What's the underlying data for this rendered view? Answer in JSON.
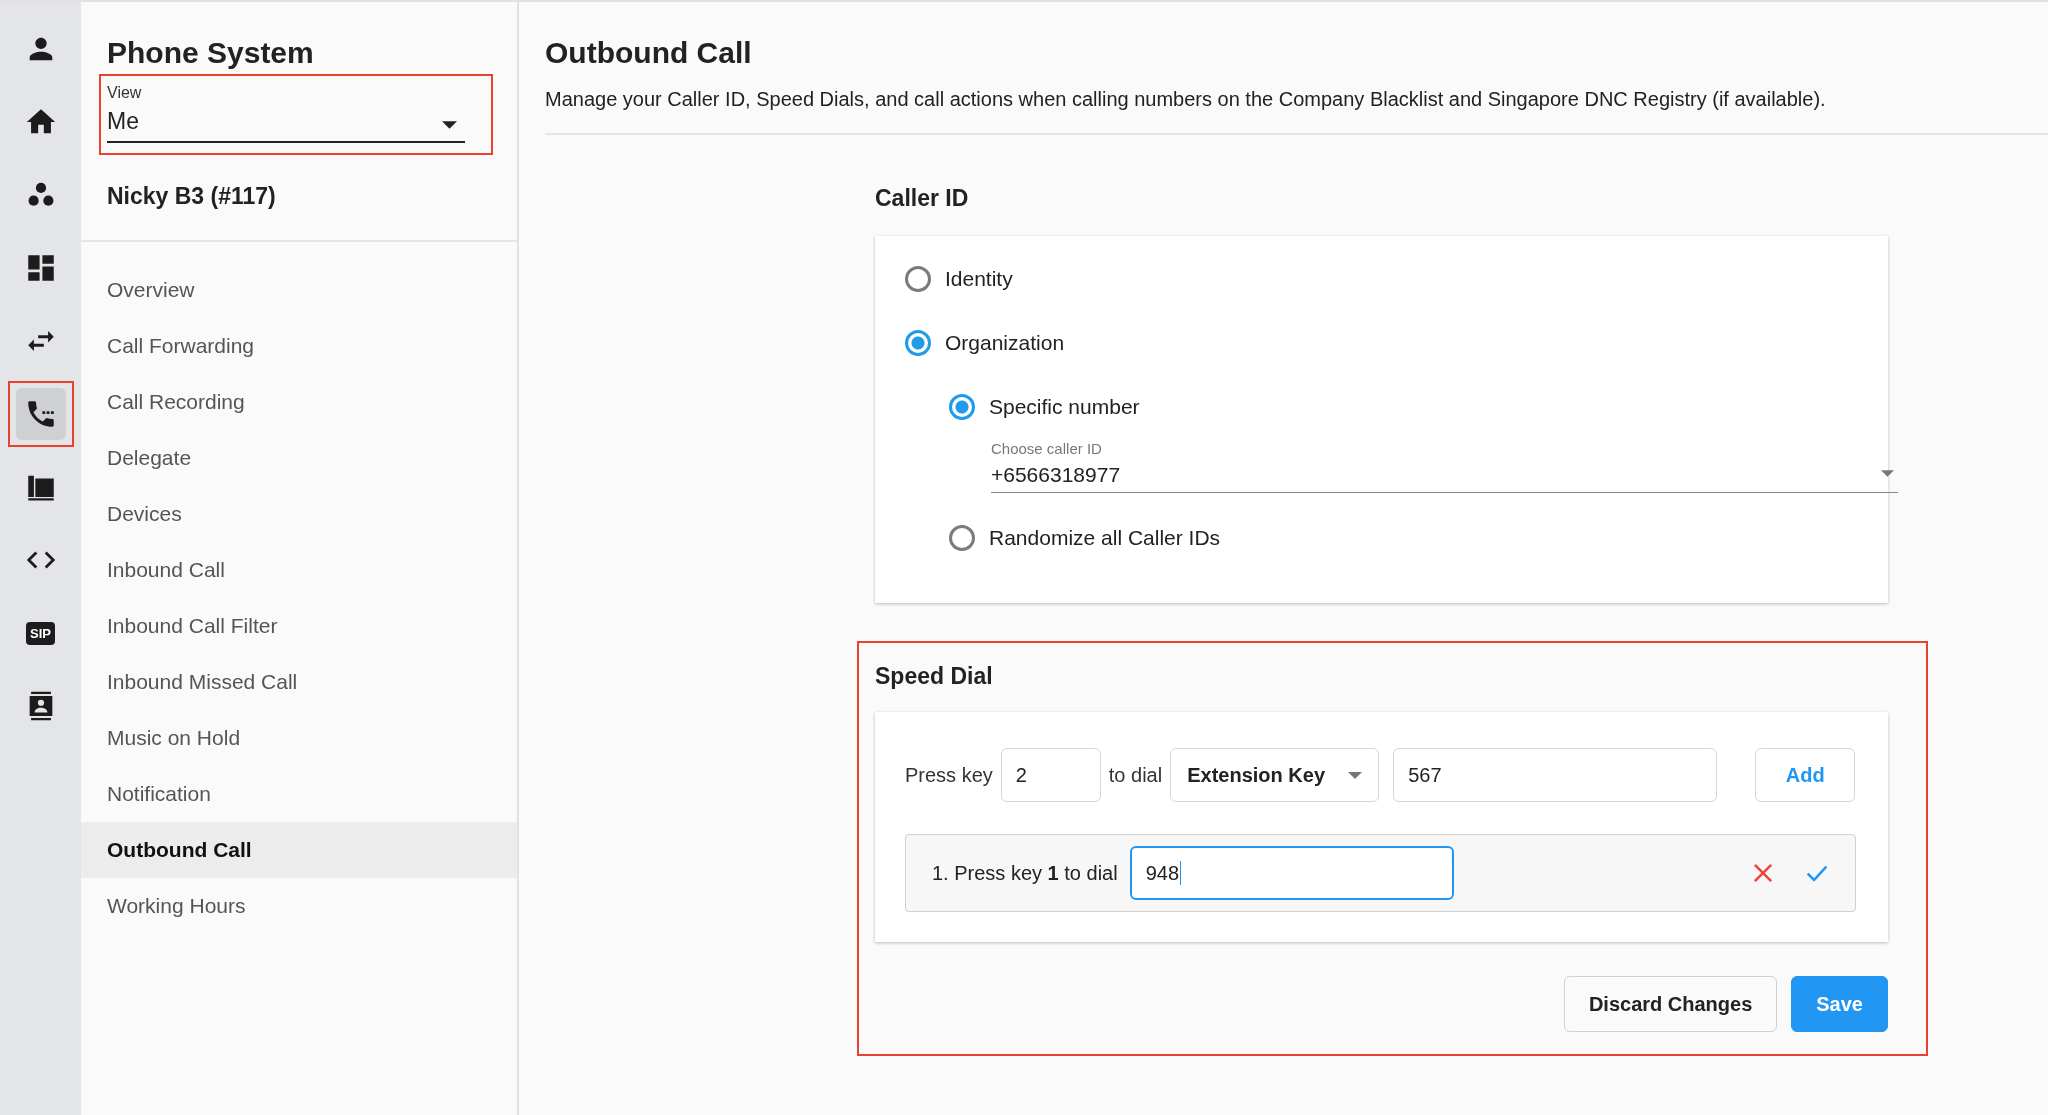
{
  "rail": {
    "items": [
      {
        "kind": "person",
        "selected": false,
        "highlighted": false
      },
      {
        "kind": "home",
        "selected": false,
        "highlighted": false
      },
      {
        "kind": "dots",
        "selected": false,
        "highlighted": false
      },
      {
        "kind": "dashboard",
        "selected": false,
        "highlighted": false
      },
      {
        "kind": "swap",
        "selected": false,
        "highlighted": false
      },
      {
        "kind": "phone",
        "selected": true,
        "highlighted": true
      },
      {
        "kind": "fax",
        "selected": false,
        "highlighted": false
      },
      {
        "kind": "code",
        "selected": false,
        "highlighted": false
      },
      {
        "kind": "sip",
        "label": "SIP",
        "selected": false,
        "highlighted": false
      },
      {
        "kind": "contact",
        "selected": false,
        "highlighted": false
      }
    ]
  },
  "sidebar": {
    "title": "Phone System",
    "view": {
      "label": "View",
      "value": "Me",
      "highlighted": true
    },
    "user": "Nicky B3 (#117)",
    "items": [
      {
        "label": "Overview",
        "selected": false
      },
      {
        "label": "Call Forwarding",
        "selected": false
      },
      {
        "label": "Call Recording",
        "selected": false
      },
      {
        "label": "Delegate",
        "selected": false
      },
      {
        "label": "Devices",
        "selected": false
      },
      {
        "label": "Inbound Call",
        "selected": false
      },
      {
        "label": "Inbound Call Filter",
        "selected": false
      },
      {
        "label": "Inbound Missed Call",
        "selected": false
      },
      {
        "label": "Music on Hold",
        "selected": false
      },
      {
        "label": "Notification",
        "selected": false
      },
      {
        "label": "Outbound Call",
        "selected": true
      },
      {
        "label": "Working Hours",
        "selected": false
      }
    ]
  },
  "main": {
    "title": "Outbound Call",
    "description": "Manage your Caller ID, Speed Dials, and call actions when calling numbers on the Company Blacklist and Singapore DNC Registry (if available).",
    "caller_id": {
      "title": "Caller ID",
      "options": [
        {
          "label": "Identity",
          "selected": false
        },
        {
          "label": "Organization",
          "selected": true,
          "children": [
            {
              "label": "Specific number",
              "selected": true,
              "select": {
                "label": "Choose caller ID",
                "value": "+6566318977"
              }
            },
            {
              "label": "Randomize all Caller IDs",
              "selected": false
            }
          ]
        }
      ]
    },
    "speed_dial": {
      "title": "Speed Dial",
      "highlighted": true,
      "new_entry": {
        "prefix": "Press key",
        "key": "2",
        "middle": "to dial",
        "type": "Extension Key",
        "number": "567",
        "add": "Add"
      },
      "entries": [
        {
          "label": "1. Press key **1** to dial",
          "value": "948",
          "focused": true
        }
      ]
    },
    "buttons": [
      {
        "label": "Discard Changes",
        "kind": "secondary"
      },
      {
        "label": "Save",
        "kind": "primary"
      }
    ]
  }
}
